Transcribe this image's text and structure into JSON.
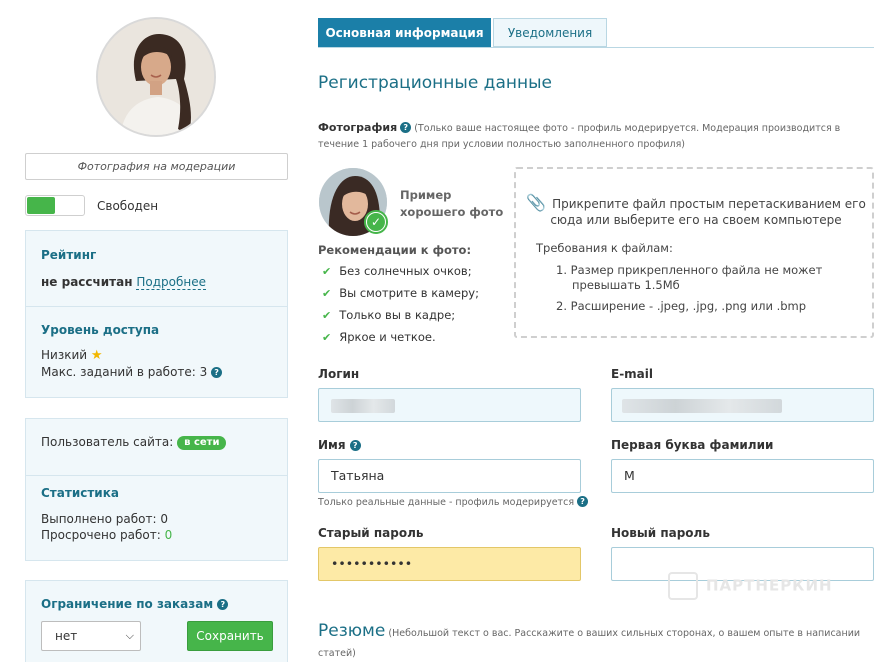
{
  "sidebar": {
    "moderation_status": "Фотография на модерации",
    "availability": "Свободен",
    "rating": {
      "title": "Рейтинг",
      "value": "не рассчитан",
      "link": "Подробнее"
    },
    "access": {
      "title": "Уровень доступа",
      "level": "Низкий",
      "max_tasks_label": "Макс. заданий в работе: 3"
    },
    "site_user": {
      "label": "Пользователь сайта:",
      "status": "в сети"
    },
    "stats": {
      "title": "Статистика",
      "done_label": "Выполнено работ:",
      "done_value": "0",
      "overdue_label": "Просрочено работ:",
      "overdue_value": "0"
    },
    "order_limit": {
      "title": "Ограничение по заказам",
      "selected": "нет",
      "save_label": "Сохранить"
    }
  },
  "tabs": [
    {
      "label": "Основная информация",
      "active": true
    },
    {
      "label": "Уведомления",
      "active": false
    }
  ],
  "registration": {
    "title": "Регистрационные данные",
    "photo_label": "Фотография",
    "photo_note": "(Только ваше настоящее фото - профиль модерируется. Модерация производится в течение 1 рабочего дня при условии полностью заполненного профиля)",
    "example_label": "Пример хорошего фото",
    "recommendations_title": "Рекомендации к фото:",
    "recommendations": [
      "Без солнечных очков;",
      "Вы смотрите в камеру;",
      "Только вы в кадре;",
      "Яркое и четкое."
    ],
    "dropzone": {
      "text": "Прикрепите файл простым перетаскиванием его сюда или выберите его на своем компьютере",
      "requirements_title": "Требования к файлам:",
      "requirements": [
        "1. Размер прикрепленного файла не может превышать 1.5Мб",
        "2. Расширение - .jpeg, .jpg, .png или .bmp"
      ]
    },
    "fields": {
      "login_label": "Логин",
      "email_label": "E-mail",
      "name_label": "Имя",
      "name_value": "Татьяна",
      "surname_initial_label": "Первая буква фамилии",
      "surname_initial_value": "М",
      "name_hint": "Только реальные данные - профиль модерируется",
      "old_password_label": "Старый пароль",
      "old_password_value": "•••••••••••",
      "new_password_label": "Новый пароль"
    }
  },
  "resume": {
    "title": "Резюме",
    "note": "(Небольшой текст о вас. Расскажите о ваших сильных сторонах, о вашем опыте в написании статей)"
  },
  "watermark": "ПАРТНЕРКИН",
  "colors": {
    "accent": "#1b6f86",
    "tab_active": "#1b7fa8",
    "success": "#46b54a",
    "warning_field": "#fdeaa6",
    "card_bg": "#f1f8fb"
  }
}
